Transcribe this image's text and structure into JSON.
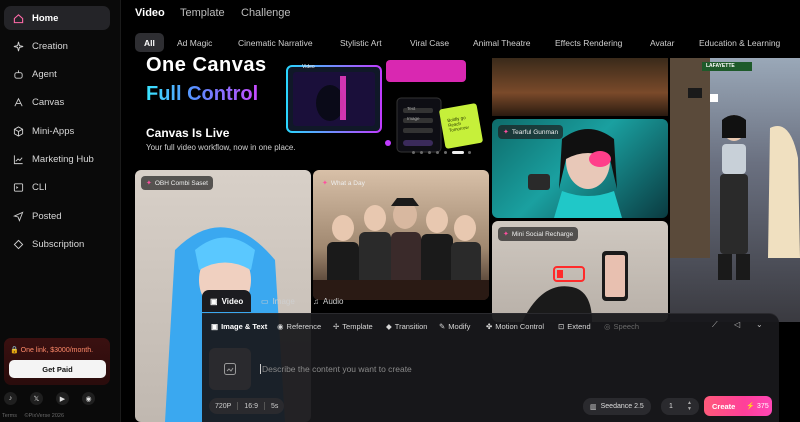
{
  "sidebar": {
    "items": [
      {
        "label": "Home",
        "icon": "home-icon"
      },
      {
        "label": "Creation",
        "icon": "sparkle-icon"
      },
      {
        "label": "Agent",
        "icon": "robot-icon"
      },
      {
        "label": "Canvas",
        "icon": "canvas-icon"
      },
      {
        "label": "Mini-Apps",
        "icon": "cube-icon"
      },
      {
        "label": "Marketing Hub",
        "icon": "chart-icon"
      },
      {
        "label": "CLI",
        "icon": "terminal-icon"
      },
      {
        "label": "Posted",
        "icon": "send-icon"
      },
      {
        "label": "Subscription",
        "icon": "diamond-icon"
      }
    ],
    "promo": {
      "text": "One link, $3000/month.",
      "button": "Get Paid"
    },
    "footer": {
      "terms": "Terms",
      "copyright": "©PixVerse 2026"
    }
  },
  "header": {
    "tabs": [
      "Video",
      "Template",
      "Challenge"
    ],
    "categories": [
      "All",
      "Ad Magic",
      "Cinematic Narrative",
      "Stylistic Art",
      "Viral Case",
      "Animal Theatre",
      "Effects Rendering",
      "Avatar",
      "Education & Learning"
    ]
  },
  "hero": {
    "title_line1": "One Canvas",
    "title_line2": "Full Control",
    "subtitle": "Canvas Is Live",
    "description": "Your full video workflow, now in one place.",
    "mock_labels": {
      "video": "Video",
      "text": "Text",
      "image": "Image",
      "note_text": "Boldly go Reach Tomorrow"
    }
  },
  "cards": {
    "tearful": "Tearful Gunman",
    "obh": "OBH Combi Saset",
    "whatday": "What a Day",
    "mini": "Mini Social Recharge",
    "street_sign": "LAFAYETTE"
  },
  "creator": {
    "modes": [
      "Video",
      "Image",
      "Audio"
    ],
    "tools": [
      "Image & Text",
      "Reference",
      "Template",
      "Transition",
      "Modify",
      "Motion Control",
      "Extend",
      "Speech"
    ],
    "prompt_placeholder": "Describe the content you want to create",
    "resolution": "720P",
    "ratio": "16:9",
    "duration": "5s",
    "model": "Seedance 2.5",
    "count": "1",
    "create_label": "Create",
    "credits": "375"
  },
  "colors": {
    "accent": "#ff3f9a",
    "promo": "#ff8a6a",
    "gradient_start": "#39e6ff",
    "gradient_end": "#c84bff"
  }
}
